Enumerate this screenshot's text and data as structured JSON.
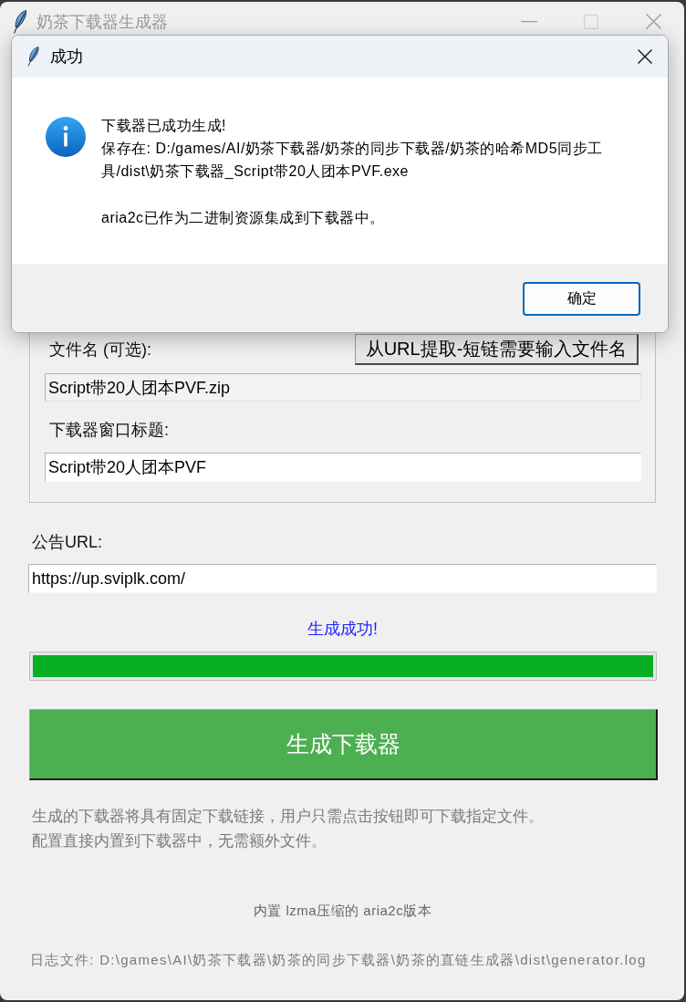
{
  "window": {
    "title": "奶茶下载器生成器",
    "active": false
  },
  "dialog": {
    "title": "成功",
    "kind": "info",
    "paragraphs": [
      [
        "下载器已成功生成!",
        "保存在: D:/games/AI/奶茶下载器/奶茶的同步下载器/奶茶的哈希MD5同步工具/dist\\奶茶下载器_Script带20人团本PVF.exe"
      ],
      [
        "aria2c已作为二进制资源集成到下载器中。"
      ]
    ],
    "buttons": [
      {
        "label": "确定",
        "default": true
      }
    ]
  },
  "form": {
    "file_name": {
      "label": "文件名 (可选):",
      "value": "Script带20人团本PVF.zip",
      "readonly": true
    },
    "extract_button": "从URL提取-短链需要输入文件名",
    "window_title": {
      "label": "下载器窗口标题:",
      "value": "Script带20人团本PVF",
      "readonly": false
    }
  },
  "notice_url": {
    "label": "公告URL:",
    "value": "https://up.sviplk.com/",
    "readonly": false
  },
  "status": "生成成功!",
  "progress": {
    "level": 1
  },
  "generate_button": "生成下载器",
  "description": [
    "生成的下载器将具有固定下载链接，用户只需点击按钮即可下载指定文件。",
    "配置直接内置到下载器中，无需额外文件。"
  ],
  "footer": {
    "version_note": "内置 lzma压缩的 aria2c版本",
    "log_file": "日志文件: D:\\games\\AI\\奶茶下载器\\奶茶的同步下载器\\奶茶的直链生成器\\dist\\generator.log"
  }
}
